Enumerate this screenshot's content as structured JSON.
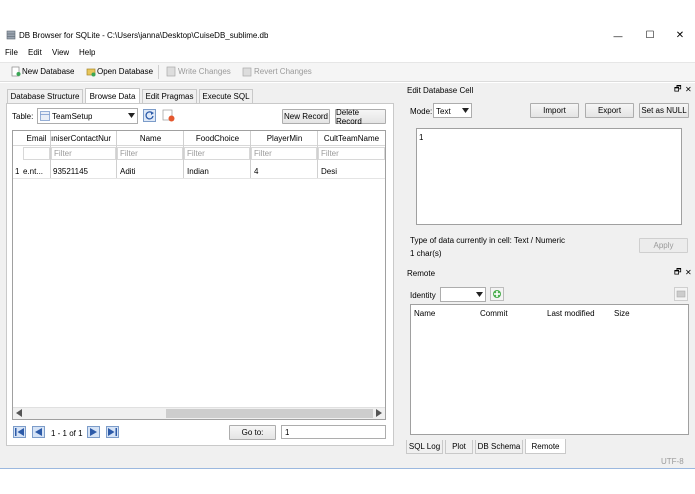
{
  "window": {
    "title": "DB Browser for SQLite - C:\\Users\\janna\\Desktop\\CuiseDB_sublime.db",
    "minimize_glyph": "—",
    "maximize_glyph": "☐",
    "close_glyph": "✕"
  },
  "menu": [
    "File",
    "Edit",
    "View",
    "Help"
  ],
  "toolbar": {
    "new_database": "New Database",
    "open_database": "Open Database",
    "write_changes": "Write Changes",
    "revert_changes": "Revert Changes"
  },
  "tabs": [
    "Database Structure",
    "Browse Data",
    "Edit Pragmas",
    "Execute SQL"
  ],
  "browse": {
    "table_label": "Table:",
    "table_name": "TeamSetup",
    "new_record": "New Record",
    "delete_record": "Delete Record",
    "columns": [
      "Email",
      "ıniserContactNur",
      "Name",
      "FoodChoice",
      "PlayerMin",
      "CultTeamName"
    ],
    "filter_placeholder": "Filter",
    "rows": [
      {
        "num": "1",
        "cells": [
          "e.nt...",
          "93521145",
          "Aditi",
          "Indian",
          "4",
          "Desi"
        ]
      }
    ],
    "pager_text": "1 - 1 of 1",
    "goto_label": "Go to:",
    "goto_value": "1"
  },
  "edit_cell": {
    "title": "Edit Database Cell",
    "mode_label": "Mode:",
    "mode_value": "Text",
    "import": "Import",
    "export": "Export",
    "set_null": "Set as NULL",
    "content": "1",
    "type_info": "Type of data currently in cell: Text / Numeric",
    "size_info": "1 char(s)",
    "apply": "Apply"
  },
  "remote": {
    "title": "Remote",
    "identity_label": "Identity",
    "columns": [
      "Name",
      "Commit",
      "Last modified",
      "Size"
    ]
  },
  "bottom_tabs": [
    "SQL Log",
    "Plot",
    "DB Schema",
    "Remote"
  ],
  "status": {
    "encoding": "UTF-8"
  },
  "dock_buttons": {
    "float": "🗗",
    "close": "✕"
  },
  "colors": {
    "accent_blue": "#3b6fc4",
    "toolbar_bg": "#f5f5f5",
    "window_bg": "#f0f0f0"
  }
}
